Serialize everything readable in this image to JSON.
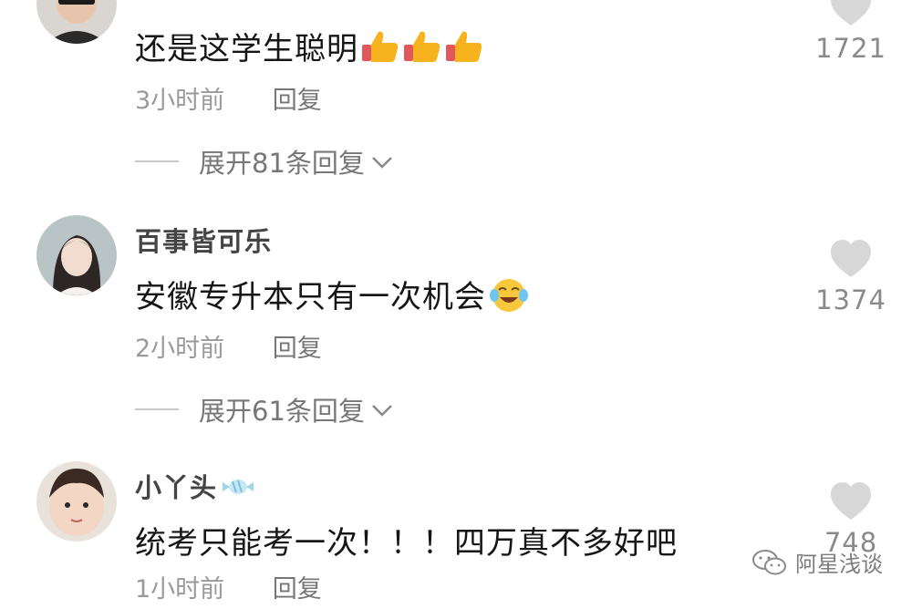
{
  "comments": [
    {
      "username": "",
      "text": "还是这学生聪明",
      "emoji": [
        "thumbs-up-icon",
        "thumbs-up-icon",
        "thumbs-up-icon"
      ],
      "time": "3小时前",
      "reply_label": "回复",
      "likes": "1721",
      "expand_label": "展开81条回复"
    },
    {
      "username": "百事皆可乐",
      "text": "安徽专升本只有一次机会",
      "emoji": [
        "laugh-cry-icon"
      ],
      "time": "2小时前",
      "reply_label": "回复",
      "likes": "1374",
      "expand_label": "展开61条回复"
    },
    {
      "username": "小丫头",
      "text": "统考只能考一次！！！四万真不多好吧",
      "emoji": [],
      "time": "1小时前",
      "reply_label": "回复",
      "likes": "748",
      "expand_label": ""
    }
  ],
  "watermark": {
    "text": "阿星浅谈",
    "icon": "wechat-icon"
  },
  "colors": {
    "text": "#161616",
    "muted": "#9a9a9a",
    "heart": "#d7d7d7",
    "thumb": "#f6b31e",
    "cuff": "#e2575c"
  }
}
